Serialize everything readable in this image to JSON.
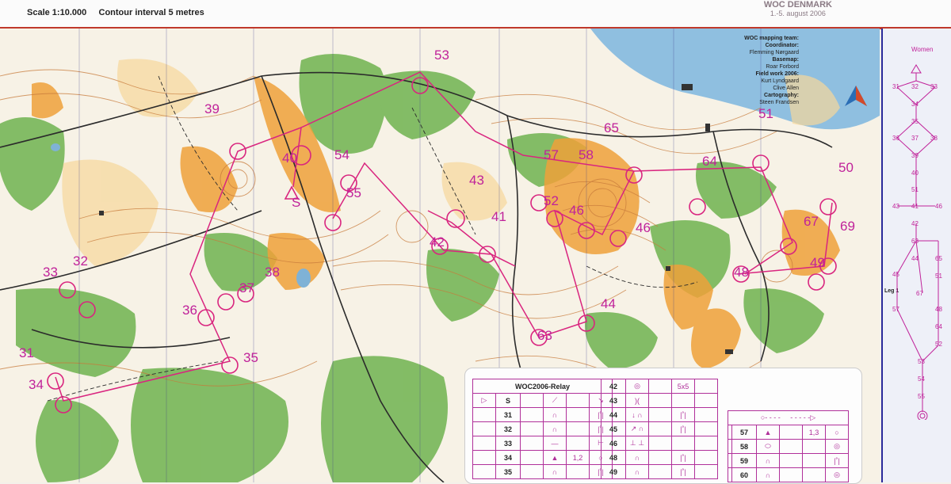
{
  "header": {
    "scale_text": "Scale 1:10.000",
    "contour_text": "Contour interval 5 metres",
    "event": "WOC DENMARK",
    "dates": "1.-5. august 2006"
  },
  "credits": {
    "team": "WOC mapping team:",
    "coordinator_label": "Coordinator:",
    "coordinator": "Flemming Nørgaard",
    "basemap_label": "Basemap:",
    "basemap": "Roar Forbord",
    "fieldwork_label": "Field work 2006:",
    "fieldwork1": "Kurt Lyndgaard",
    "fieldwork2": "Clive Allen",
    "cartography_label": "Cartography:",
    "cartography": "Steen Frandsen"
  },
  "map": {
    "control_labels": [
      "53",
      "39",
      "40",
      "54",
      "55",
      "S",
      "43",
      "57",
      "58",
      "65",
      "64",
      "51",
      "50",
      "52",
      "46",
      "42",
      "41",
      "46",
      "67",
      "69",
      "49",
      "48",
      "33",
      "32",
      "38",
      "37",
      "36",
      "35",
      "31",
      "34",
      "63",
      "44"
    ],
    "colors": {
      "forest": "#6ab04c",
      "open": "#f0a030",
      "water": "#7fb2d6",
      "course": "#d9257f",
      "contour": "#c77a3a",
      "road": "#2b2b2b"
    }
  },
  "sidebar": {
    "title": "Women",
    "leg": "Leg 1",
    "nodes": [
      "31",
      "32",
      "33",
      "34",
      "35",
      "36",
      "37",
      "38",
      "39",
      "40",
      "51",
      "41",
      "42",
      "43",
      "63",
      "44",
      "46",
      "45",
      "65",
      "51",
      "67",
      "57",
      "48",
      "64",
      "52",
      "53",
      "54",
      "55"
    ]
  },
  "description": {
    "title": "WOC2006-Relay",
    "start": "S",
    "col1": [
      "31",
      "32",
      "33",
      "34",
      "35"
    ],
    "col2": [
      "42",
      "43",
      "44",
      "45",
      "46",
      "48",
      "49"
    ],
    "col2_extra": "5x5",
    "col3": [
      "57",
      "58",
      "59",
      "60"
    ],
    "col3_extra": "1,3",
    "col1_extra": "1,2"
  }
}
